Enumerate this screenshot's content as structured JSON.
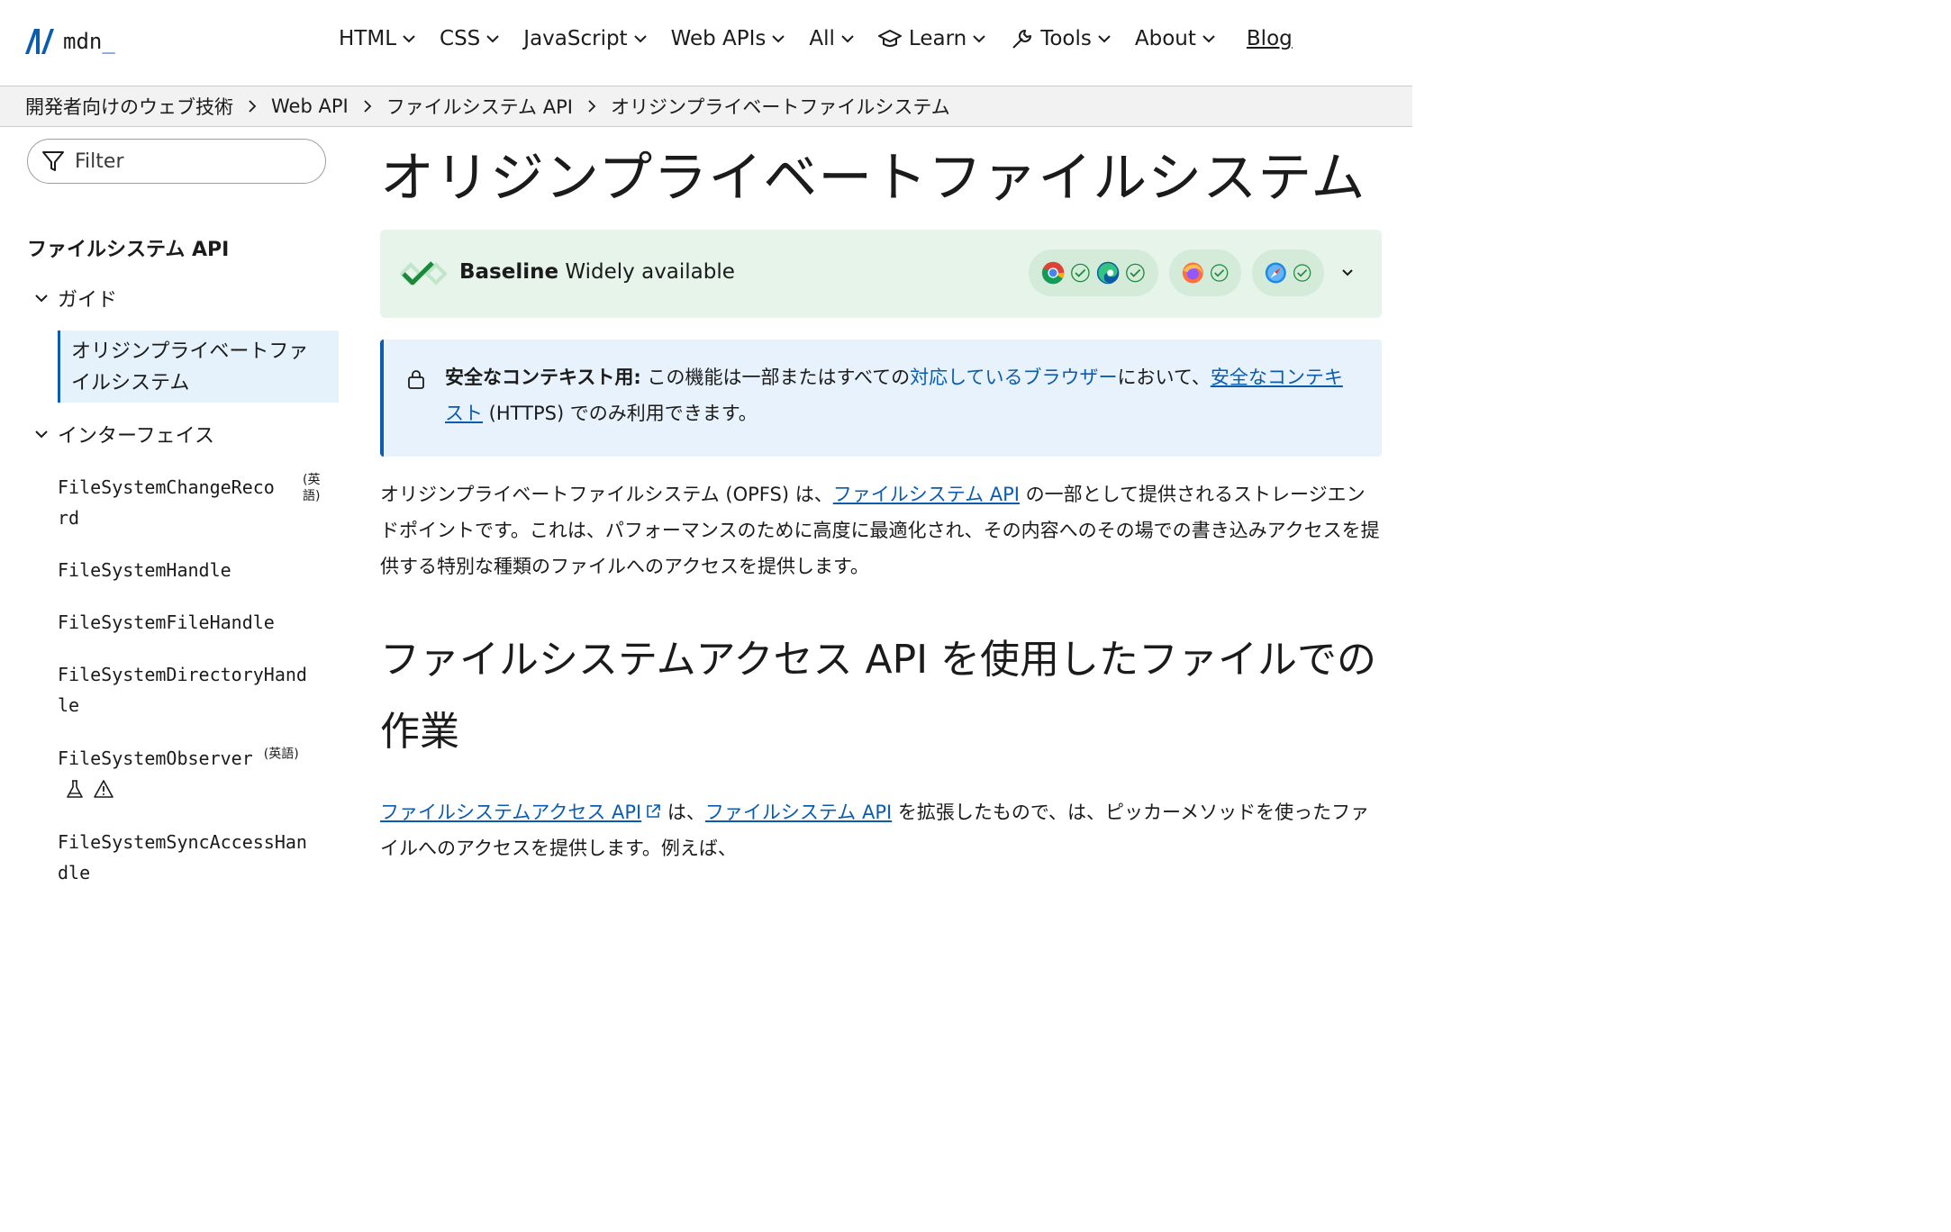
{
  "header": {
    "logo_text": "mdn",
    "logo_underscore": "_",
    "nav": [
      {
        "label": "HTML"
      },
      {
        "label": "CSS"
      },
      {
        "label": "JavaScript"
      },
      {
        "label": "Web APIs"
      },
      {
        "label": "All"
      },
      {
        "label": "Learn",
        "icon": "graduation-cap-icon"
      },
      {
        "label": "Tools",
        "icon": "wrench-icon"
      },
      {
        "label": "About"
      }
    ],
    "blog": "Blog"
  },
  "breadcrumb": [
    "開発者向けのウェブ技術",
    "Web API",
    "ファイルシステム API",
    "オリジンプライベートファイルシステム"
  ],
  "sidebar": {
    "filter_placeholder": "Filter",
    "title": "ファイルシステム API",
    "group_guides": "ガイド",
    "active_item_line1": "オリジンプライベートファ",
    "active_item_line2": "イルシステム",
    "group_interfaces": "インターフェイス",
    "items": {
      "change_record_l1": "FileSystemChangeReco",
      "change_record_l2": "rd",
      "change_record_tag_l1": "(英",
      "change_record_tag_l2": "語)",
      "handle": "FileSystemHandle",
      "file_handle": "FileSystemFileHandle",
      "dir_handle_l1": "FileSystemDirectoryHand",
      "dir_handle_l2": "le",
      "observer": "FileSystemObserver",
      "observer_tag": "(英語)",
      "sync_l1": "FileSystemSyncAccessHan",
      "sync_l2": "dle"
    }
  },
  "main": {
    "title": "オリジンプライベートファイルシステム",
    "baseline": {
      "label_bold": "Baseline",
      "label_rest": " Widely available",
      "browsers": [
        "chrome-icon",
        "edge-icon",
        "firefox-icon",
        "safari-icon"
      ],
      "accent": "#1a8a3a"
    },
    "notice": {
      "bold": "安全なコンテキスト用:",
      "t1": " この機能は一部またはすべての",
      "link1": "対応しているブラウザー",
      "t2": "において、",
      "link2": "安全なコンテキスト",
      "t3": " (HTTPS) でのみ利用できます。"
    },
    "intro": {
      "t1": "オリジンプライベートファイルシステム (OPFS) は、",
      "link": "ファイルシステム API",
      "t2": " の一部として提供されるストレージエンドポイントです。これは、パフォーマンスのために高度に最適化され、その内容へのその場での書き込みアクセスを提供する特別な種類のファイルへのアクセスを提供します。"
    },
    "section_heading": "ファイルシステムアクセス API を使用したファイルでの作業",
    "section_para": {
      "link1": "ファイルシステムアクセス API",
      "t1": " は、",
      "link2": "ファイルシステム API",
      "t2": " を拡張したもので、は、ピッカーメソッドを使ったファイルへのアクセスを提供します。例えば、"
    }
  }
}
